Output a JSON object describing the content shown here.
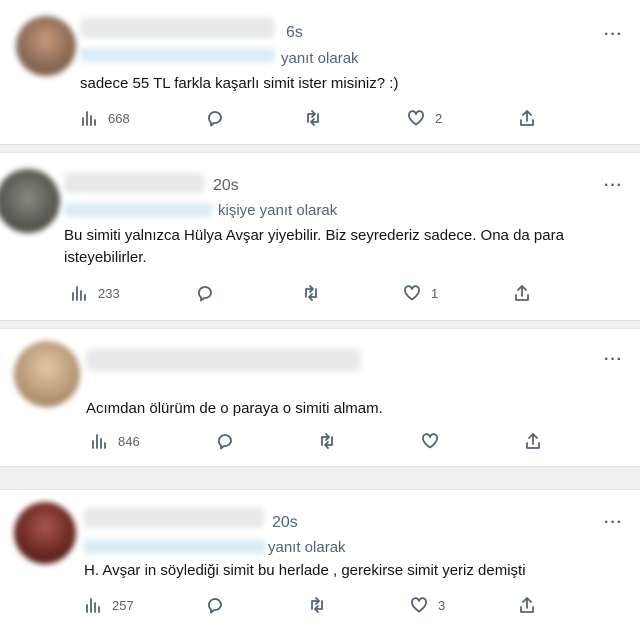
{
  "tweets": [
    {
      "time": "6s",
      "reply_label": "yanıt olarak",
      "text": "sadece 55 TL farkla kaşarlı simit ister misiniz? :)",
      "views": "668",
      "likes": "2",
      "avatar_color": "#8b6a55"
    },
    {
      "time": "20s",
      "reply_label": "kişiye yanıt olarak",
      "text_line1": "Bu simiti yalnızca  Hülya Avşar yiyebilir. Biz seyrederiz sadece. Ona da para",
      "text_line2": "isteyebilirler.",
      "views": "233",
      "likes": "1",
      "avatar_color": "#5c5a52"
    },
    {
      "text": "Acımdan ölürüm de o paraya o simiti almam.",
      "views": "846",
      "avatar_color": "#b89a78"
    },
    {
      "time": "20s",
      "reply_label": "yanıt olarak",
      "text": "H. Avşar in söylediği simit bu herlade , gerekirse simit yeriz demişti",
      "views": "257",
      "likes": "3",
      "avatar_color": "#6b2a22"
    }
  ],
  "more_label": "···",
  "colors": {
    "text_primary": "#0f1419",
    "text_secondary": "#536471",
    "separator": "#eef0f1"
  }
}
